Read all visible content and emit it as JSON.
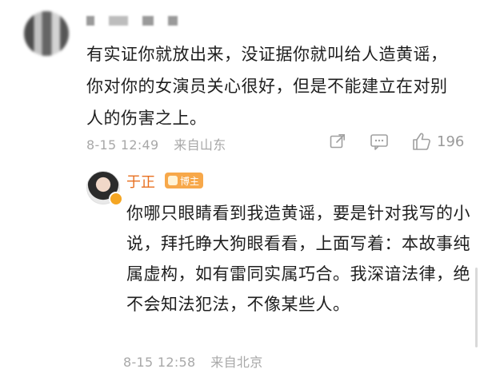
{
  "comment": {
    "text": "有实证你就放出来，没证据你就叫给人造黄谣，你对你的女演员关心很好，但是不能建立在对别人的伤害之上。",
    "time": "8-15 12:49",
    "location": "来自山东",
    "like_count": "196"
  },
  "reply": {
    "author": "于正",
    "badge": "博主",
    "text": "你哪只眼睛看到我造黄谣，要是针对我写的小说，拜托睁大狗眼看看，上面写着：本故事纯属虚构，如有雷同实属巧合。我深谙法律，绝不会知法犯法，不像某些人。",
    "time": "8-15 12:58",
    "location": "来自北京"
  },
  "icons": {
    "share": "share-icon",
    "comment": "comment-icon",
    "like": "like-icon"
  },
  "colors": {
    "author_name": "#e86f1f",
    "badge_bg": "#f7a84a",
    "meta": "#a8a8a8"
  }
}
